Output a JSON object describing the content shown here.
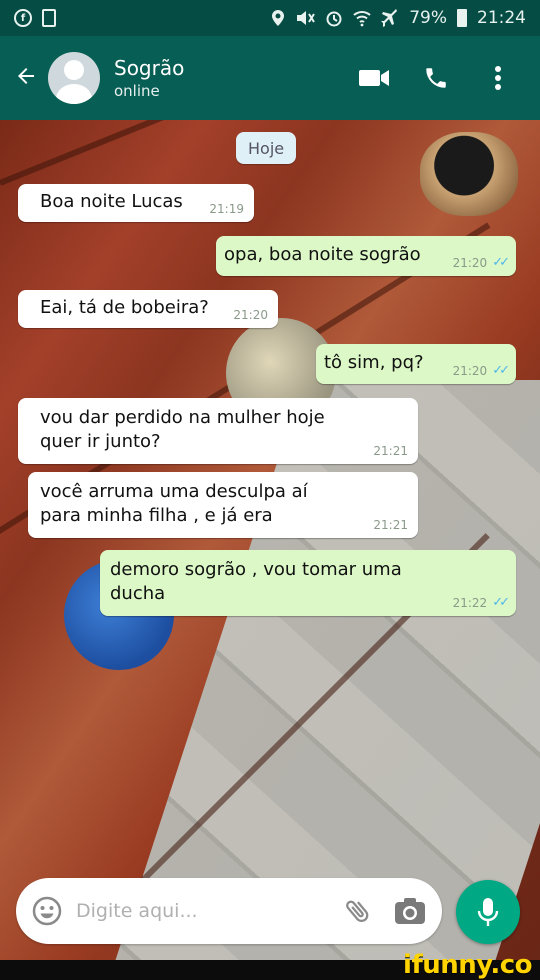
{
  "status_bar": {
    "battery": "79%",
    "time": "21:24"
  },
  "app_bar": {
    "contact_name": "Sogrão",
    "contact_status": "online"
  },
  "chat": {
    "date_label": "Hoje",
    "messages": [
      {
        "text": "Boa noite Lucas",
        "time": "21:19"
      },
      {
        "text": "opa, boa noite sogrão",
        "time": "21:20"
      },
      {
        "text": "Eai, tá de bobeira?",
        "time": "21:20"
      },
      {
        "text": "tô sim, pq?",
        "time": "21:20"
      },
      {
        "text": "vou dar perdido na mulher hoje quer ir junto?",
        "time": "21:21"
      },
      {
        "text": "você arruma uma desculpa aí para minha filha , e já era",
        "time": "21:21"
      },
      {
        "text": "demoro sogrão , vou tomar uma ducha",
        "time": "21:22"
      }
    ]
  },
  "composer": {
    "placeholder": "Digite aqui..."
  },
  "watermark": "ifunny.co",
  "colors": {
    "header": "#075e54",
    "status_bar": "#054d44",
    "outgoing_bubble": "#dcf8c6",
    "incoming_bubble": "#ffffff",
    "accent": "#00a884",
    "read_ticks": "#4fb6ec"
  },
  "icons": {
    "back": "arrow-left-icon",
    "video": "video-camera-icon",
    "call": "phone-icon",
    "menu": "more-vertical-icon",
    "emoji": "emoji-icon",
    "attach": "paperclip-icon",
    "camera": "camera-icon",
    "mic": "microphone-icon"
  }
}
